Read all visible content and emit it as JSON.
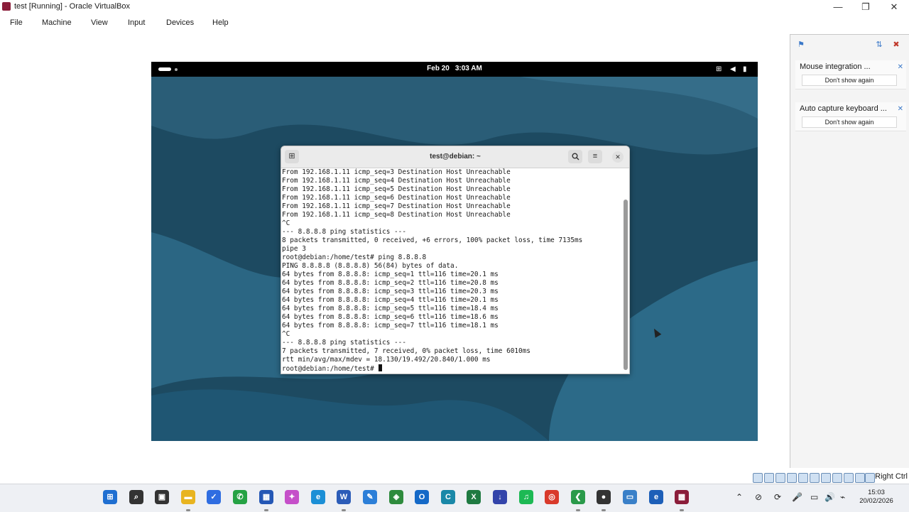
{
  "window": {
    "title": "test [Running] - Oracle VirtualBox",
    "controls": [
      "—",
      "❐",
      "✕"
    ]
  },
  "menu": [
    "File",
    "Machine",
    "View",
    "Input",
    "Devices",
    "Help"
  ],
  "guest": {
    "topbar": {
      "date": "Feb 20",
      "time": "3:03 AM",
      "icons": [
        "network-icon",
        "volume-icon",
        "battery-icon"
      ]
    },
    "terminal": {
      "title": "test@debian: ~",
      "buttons": {
        "new_tab": "⊞",
        "search": "🔍",
        "menu": "≡",
        "close": "✕"
      },
      "lines": [
        "From 192.168.1.11 icmp_seq=3 Destination Host Unreachable",
        "From 192.168.1.11 icmp_seq=4 Destination Host Unreachable",
        "From 192.168.1.11 icmp_seq=5 Destination Host Unreachable",
        "From 192.168.1.11 icmp_seq=6 Destination Host Unreachable",
        "From 192.168.1.11 icmp_seq=7 Destination Host Unreachable",
        "From 192.168.1.11 icmp_seq=8 Destination Host Unreachable",
        "^C",
        "--- 8.8.8.8 ping statistics ---",
        "8 packets transmitted, 0 received, +6 errors, 100% packet loss, time 7135ms",
        "pipe 3",
        "root@debian:/home/test# ping 8.8.8.8",
        "PING 8.8.8.8 (8.8.8.8) 56(84) bytes of data.",
        "64 bytes from 8.8.8.8: icmp_seq=1 ttl=116 time=20.1 ms",
        "64 bytes from 8.8.8.8: icmp_seq=2 ttl=116 time=20.8 ms",
        "64 bytes from 8.8.8.8: icmp_seq=3 ttl=116 time=20.3 ms",
        "64 bytes from 8.8.8.8: icmp_seq=4 ttl=116 time=20.1 ms",
        "64 bytes from 8.8.8.8: icmp_seq=5 ttl=116 time=18.4 ms",
        "64 bytes from 8.8.8.8: icmp_seq=6 ttl=116 time=18.6 ms",
        "64 bytes from 8.8.8.8: icmp_seq=7 ttl=116 time=18.1 ms",
        "^C",
        "--- 8.8.8.8 ping statistics ---",
        "7 packets transmitted, 7 received, 0% packet loss, time 6010ms",
        "rtt min/avg/max/mdev = 18.130/19.492/20.840/1.000 ms"
      ],
      "prompt": "root@debian:/home/test# "
    }
  },
  "notifications": [
    {
      "text": "Mouse integration ...",
      "button": "Don't show again"
    },
    {
      "text": "Auto capture keyboard ...",
      "button": "Don't show again"
    }
  ],
  "statusbar": {
    "host_key": "Right Ctrl"
  },
  "taskbar": {
    "apps": [
      {
        "name": "start-button",
        "glyph": "⊞",
        "color": "#1f6fd1"
      },
      {
        "name": "search",
        "glyph": "⌕",
        "color": "#333333"
      },
      {
        "name": "task-view",
        "glyph": "▣",
        "color": "#333333"
      },
      {
        "name": "file-explorer",
        "glyph": "▬",
        "color": "#e8b420"
      },
      {
        "name": "todo",
        "glyph": "✓",
        "color": "#2f6de1"
      },
      {
        "name": "whatsapp",
        "glyph": "✆",
        "color": "#25a244"
      },
      {
        "name": "store",
        "glyph": "▦",
        "color": "#2457b5"
      },
      {
        "name": "copilot",
        "glyph": "✦",
        "color": "#c54fc9"
      },
      {
        "name": "edge",
        "glyph": "e",
        "color": "#1b8fd6"
      },
      {
        "name": "word",
        "glyph": "W",
        "color": "#2b5cb8"
      },
      {
        "name": "sketch",
        "glyph": "✎",
        "color": "#2c7fd8"
      },
      {
        "name": "shield",
        "glyph": "◈",
        "color": "#2e8b3d"
      },
      {
        "name": "outlook",
        "glyph": "O",
        "color": "#1569c7"
      },
      {
        "name": "cursor-app",
        "glyph": "C",
        "color": "#1a88a8"
      },
      {
        "name": "excel",
        "glyph": "X",
        "color": "#1f7a41"
      },
      {
        "name": "downloader",
        "glyph": "↓",
        "color": "#3344aa"
      },
      {
        "name": "spotify",
        "glyph": "♫",
        "color": "#1db954"
      },
      {
        "name": "chrome",
        "glyph": "◎",
        "color": "#d93a2b"
      },
      {
        "name": "vscode-insiders",
        "glyph": "❮",
        "color": "#2a9a4a"
      },
      {
        "name": "recorder",
        "glyph": "●",
        "color": "#333333"
      },
      {
        "name": "remote-desktop",
        "glyph": "▭",
        "color": "#3a80c8"
      },
      {
        "name": "edge-dev",
        "glyph": "e",
        "color": "#1d5fb8"
      },
      {
        "name": "virtualbox",
        "glyph": "▩",
        "color": "#8b1d3a"
      }
    ],
    "tray": [
      "⌃",
      "⊘",
      "⟳",
      "🎤",
      "▭",
      "🔊",
      "⌁"
    ],
    "time": "15:03",
    "date": "20/02/2026"
  }
}
